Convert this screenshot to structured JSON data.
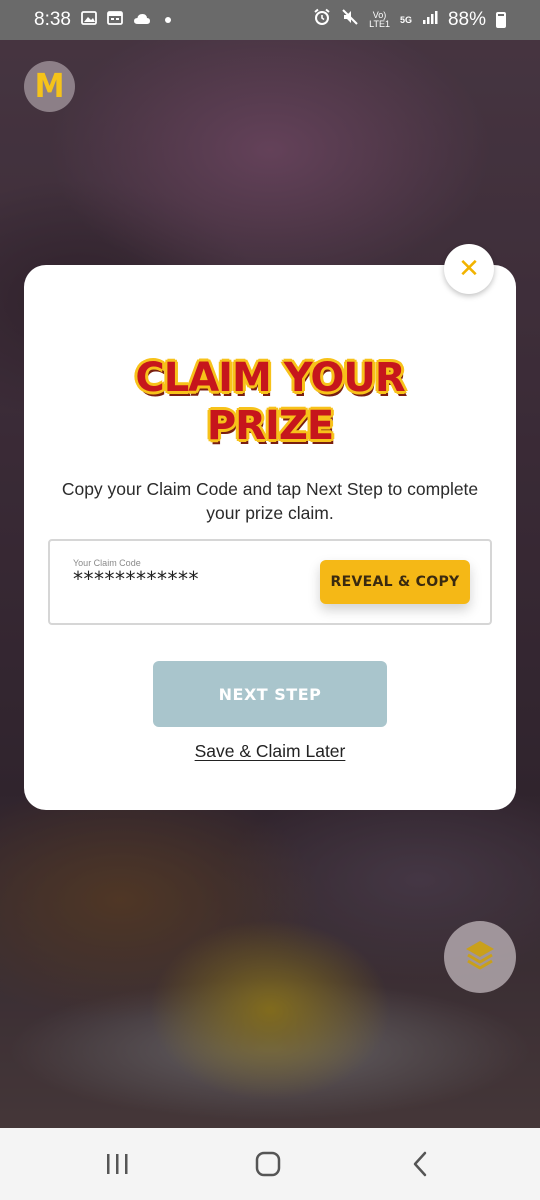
{
  "status_bar": {
    "time": "8:38",
    "network_top": "Vo)",
    "network_bottom": "LTE1",
    "network_type": "5G",
    "battery": "88%"
  },
  "app": {
    "logo_glyph": "M"
  },
  "modal": {
    "close_glyph": "✕",
    "title_line1": "CLAIM YOUR",
    "title_line2": "PRIZE",
    "description": "Copy your Claim Code and tap Next Step to complete your prize claim.",
    "claim_code_label": "Your Claim Code",
    "claim_code_value": "************",
    "reveal_copy_label": "REVEAL & COPY",
    "next_step_label": "NEXT STEP",
    "save_later_label": "Save & Claim Later"
  },
  "colors": {
    "accent_yellow": "#f5b816",
    "title_red": "#c6161c",
    "next_step_disabled": "#a9c5cc"
  },
  "icons": {
    "status_left": [
      "image-icon",
      "calendar-icon",
      "cloud-icon",
      "dot-icon"
    ],
    "status_right": [
      "alarm-icon",
      "mute-icon",
      "signal-icon",
      "battery-icon"
    ],
    "floating": "layers-icon",
    "nav": [
      "recent-apps-icon",
      "home-icon",
      "back-icon"
    ]
  }
}
